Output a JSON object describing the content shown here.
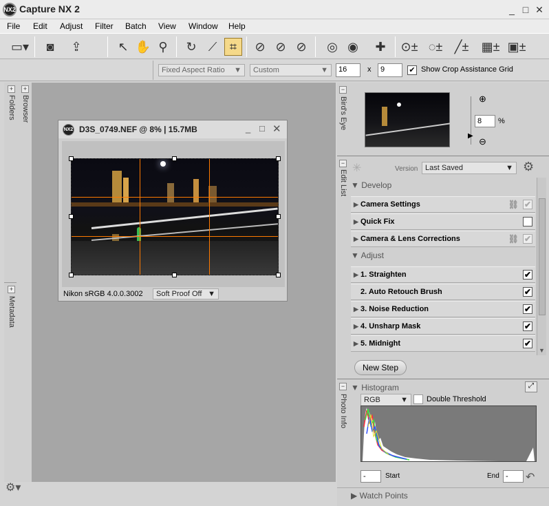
{
  "app": {
    "title": "Capture NX 2",
    "logo": "NX2"
  },
  "window_controls": {
    "minimize": "_",
    "maximize": "□",
    "close": "✕"
  },
  "menu": [
    "File",
    "Edit",
    "Adjust",
    "Filter",
    "Batch",
    "View",
    "Window",
    "Help"
  ],
  "toolbar": {
    "icons": [
      "browser-toggle-icon",
      "camera-icon",
      "export-icon",
      "direct-select-icon",
      "hand-icon",
      "zoom-icon",
      "rotate-icon",
      "straighten-icon",
      "crop-icon",
      "black-point-icon",
      "neutral-point-icon",
      "white-point-icon",
      "red-eye-icon",
      "auto-retouch-icon",
      "control-point-icon",
      "lasso-icon",
      "brush-icon",
      "gradient-icon",
      "fill-icon"
    ]
  },
  "options_bar": {
    "aspect_mode": "Fixed Aspect Ratio",
    "preset": "Custom",
    "width": "16",
    "times": "x",
    "height": "9",
    "show_grid_checked": true,
    "show_grid_label": "Show Crop Assistance Grid"
  },
  "left_tabs": {
    "folders": "Folders",
    "browser": "Browser",
    "metadata": "Metadata"
  },
  "image_window": {
    "title": "D3S_0749.NEF @ 8% | 15.7MB",
    "logo": "NX2",
    "profile": "Nikon sRGB 4.0.0.3002",
    "proof": "Soft Proof Off"
  },
  "birds_eye": {
    "tab": "Bird's Eye",
    "zoom": "8",
    "unit": "%"
  },
  "edit_list": {
    "tab": "Edit List",
    "version_label": "Version",
    "version_value": "Last Saved",
    "develop_label": "Develop",
    "develop_items": [
      {
        "label": "Camera Settings",
        "checked": true,
        "linked": true
      },
      {
        "label": "Quick Fix",
        "checked": false,
        "linked": false
      },
      {
        "label": "Camera & Lens Corrections",
        "checked": true,
        "linked": true
      }
    ],
    "adjust_label": "Adjust",
    "adjust_items": [
      {
        "label": "1. Straighten",
        "checked": true
      },
      {
        "label": "2. Auto Retouch Brush",
        "checked": true
      },
      {
        "label": "3. Noise Reduction",
        "checked": true
      },
      {
        "label": "4. Unsharp Mask",
        "checked": true
      },
      {
        "label": "5. Midnight",
        "checked": true
      }
    ],
    "new_step": "New Step"
  },
  "photo_info": {
    "tab": "Photo Info",
    "histogram_label": "Histogram",
    "channel": "RGB",
    "double_threshold": "Double Threshold",
    "start_label": "Start",
    "end_label": "End",
    "start_value": "-",
    "end_value": "-",
    "watch_points": "Watch Points"
  },
  "colors": {
    "crop_grid": "#ff7a00",
    "active_tool": "#f5d98a"
  }
}
